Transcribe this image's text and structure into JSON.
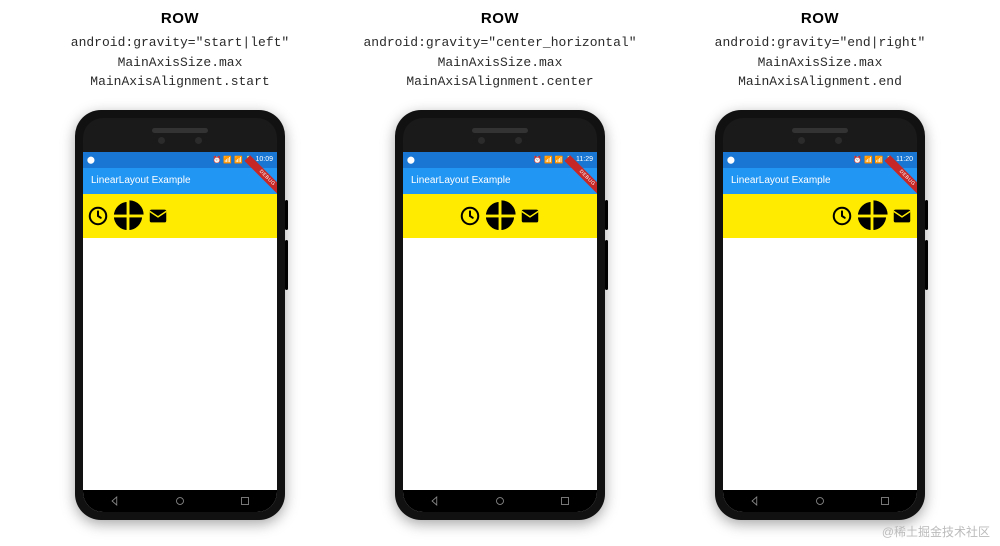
{
  "columns": [
    {
      "title": "ROW",
      "gravity_line": "android:gravity=\"start|left\"",
      "size_line": "MainAxisSize.max",
      "align_line": "MainAxisAlignment.start",
      "justify": "j-start",
      "time": "10:09"
    },
    {
      "title": "ROW",
      "gravity_line": "android:gravity=\"center_horizontal\"",
      "size_line": "MainAxisSize.max",
      "align_line": "MainAxisAlignment.center",
      "justify": "j-center",
      "time": "11:29"
    },
    {
      "title": "ROW",
      "gravity_line": "android:gravity=\"end|right\"",
      "size_line": "MainAxisSize.max",
      "align_line": "MainAxisAlignment.end",
      "justify": "j-end",
      "time": "11:20"
    }
  ],
  "appbar_title": "LinearLayout Example",
  "debug_label": "DEBUG",
  "status_icons": "⏰ 📶 📶 🔋",
  "left_icon": "⬤",
  "watermark": "@稀土掘金技术社区"
}
